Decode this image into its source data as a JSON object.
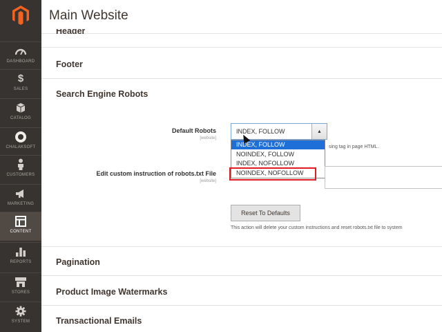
{
  "window": {
    "title": "Main Website"
  },
  "sidebar": {
    "items": [
      {
        "label": "DASHBOARD",
        "icon": "gauge-icon"
      },
      {
        "label": "SALES",
        "icon": "dollar-icon"
      },
      {
        "label": "CATALOG",
        "icon": "cube-icon"
      },
      {
        "label": "CHALAKSOFT",
        "icon": "circle-icon"
      },
      {
        "label": "CUSTOMERS",
        "icon": "person-icon"
      },
      {
        "label": "MARKETING",
        "icon": "megaphone-icon"
      },
      {
        "label": "CONTENT",
        "icon": "layout-icon",
        "active": true
      },
      {
        "label": "REPORTS",
        "icon": "bar-chart-icon"
      },
      {
        "label": "STORES",
        "icon": "store-icon"
      },
      {
        "label": "SYSTEM",
        "icon": "gear-icon"
      }
    ]
  },
  "sections": {
    "header": "Header",
    "footer": "Footer",
    "search_engine_robots": "Search Engine Robots",
    "pagination": "Pagination",
    "product_image_watermarks": "Product Image Watermarks",
    "transactional_emails": "Transactional Emails"
  },
  "robots": {
    "default_label": "Default Robots",
    "default_scope": "[website]",
    "selected_value": "INDEX, FOLLOW",
    "options": [
      "INDEX, FOLLOW",
      "NOINDEX, FOLLOW",
      "INDEX, NOFOLLOW",
      "NOINDEX, NOFOLLOW"
    ],
    "note": "sing tag in page HTML.",
    "custom_label": "Edit custom instruction of robots.txt File",
    "custom_scope": "[website]",
    "reset_button": "Reset To Defaults",
    "reset_note": "This action will delete your custom instructions and reset robots.txt file to system"
  },
  "colors": {
    "sidebar_bg": "#373330",
    "active_bg": "#514943",
    "selection_blue": "#1e6fd8",
    "highlight_red": "#e01b22",
    "logo_orange": "#f26322"
  }
}
